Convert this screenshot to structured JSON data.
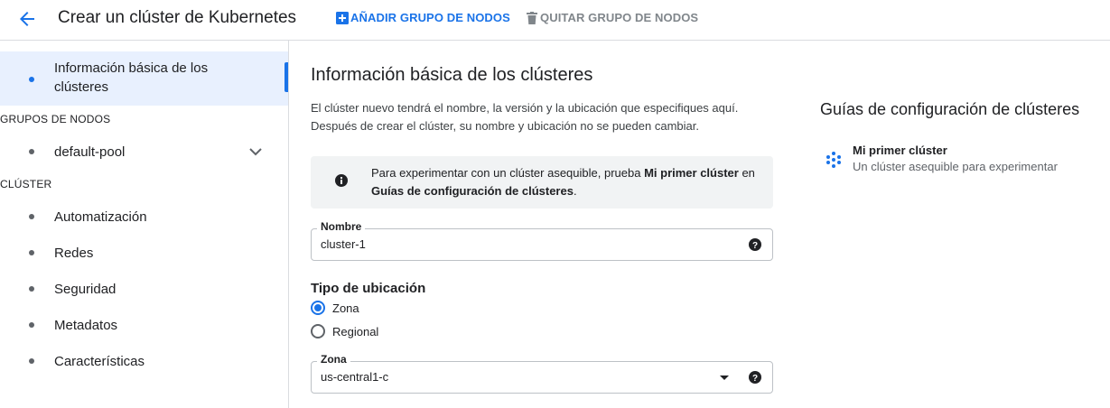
{
  "header": {
    "title": "Crear un clúster de Kubernetes",
    "add_node_pool": "AÑADIR GRUPO DE NODOS",
    "remove_node_pool": "QUITAR GRUPO DE NODOS",
    "accent_color": "#1a73e8"
  },
  "sidebar": {
    "active_item": "Información básica de los clústeres",
    "sections": [
      {
        "header": "GRUPOS DE NODOS",
        "items": [
          "default-pool"
        ]
      },
      {
        "header": "CLÚSTER",
        "items": [
          "Automatización",
          "Redes",
          "Seguridad",
          "Metadatos",
          "Características"
        ]
      }
    ],
    "item_active_line1": "Información básica de los",
    "item_active_line2": "clústeres",
    "section_nodes": "GRUPOS DE NODOS",
    "item_default_pool": "default-pool",
    "section_cluster": "CLÚSTER",
    "item_automation": "Automatización",
    "item_networking": "Redes",
    "item_security": "Seguridad",
    "item_metadata": "Metadatos",
    "item_features": "Características"
  },
  "main": {
    "title": "Información básica de los clústeres",
    "desc_line1": "El clúster nuevo tendrá el nombre, la versión y la ubicación que especifiques aquí.",
    "desc_line2": "Después de crear el clúster, su nombre y ubicación no se pueden cambiar.",
    "info": {
      "text1": "Para experimentar con un clúster asequible, prueba ",
      "link1": "Mi primer clúster",
      "text2": " en",
      "link2": "Guías de configuración de clústeres",
      "text3": "."
    },
    "name_field": {
      "label": "Nombre",
      "value": "cluster-1"
    },
    "location_type": {
      "title": "Tipo de ubicación",
      "options": [
        "Zona",
        "Regional"
      ],
      "selected": "Zona",
      "opt_zone": "Zona",
      "opt_regional": "Regional"
    },
    "zone_field": {
      "label": "Zona",
      "value": "us-central1-c"
    }
  },
  "guides": {
    "title": "Guías de configuración de clústeres",
    "item_name": "Mi primer clúster",
    "item_desc": "Un clúster asequible para experimentar"
  }
}
